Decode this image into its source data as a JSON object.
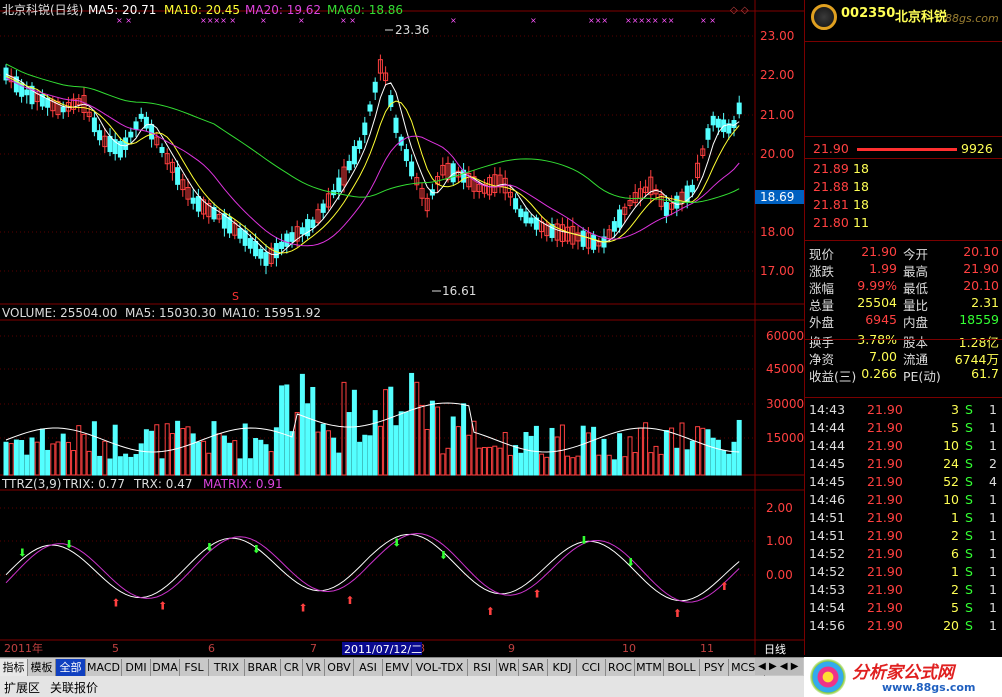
{
  "header": {
    "title": "北京科锐(日线)",
    "ma5": "MA5: 20.71",
    "ma10": "MA10: 20.45",
    "ma20": "MA20: 19.62",
    "ma60": "MA60: 18.86"
  },
  "price_axis": [
    "23.00",
    "22.00",
    "21.00",
    "20.00",
    "18.00",
    "17.00"
  ],
  "price_marker": "18.69",
  "hi_label": "23.36",
  "lo_label": "16.61",
  "signal_s": "S",
  "volume": {
    "label": "VOLUME: 25504.00",
    "ma5": "MA5: 15030.30",
    "ma10": "MA10: 15951.92",
    "axis": [
      "60000",
      "45000",
      "30000",
      "15000"
    ]
  },
  "trix": {
    "label": "TTRZ(3,9)",
    "trix": "TRIX: 0.77",
    "trx": "TRX: 0.47",
    "matrix": "MATRIX: 0.91",
    "axis": [
      "2.00",
      "1.00",
      "0.00"
    ]
  },
  "date_axis": {
    "year": "2011年",
    "months": [
      "5",
      "6",
      "7",
      "8",
      "9",
      "10",
      "11"
    ],
    "cursor": "2011/07/12/二",
    "period": "日线"
  },
  "colors": {
    "up": "#ff4040",
    "down": "#54ffff",
    "ma5": "#ffffff",
    "ma10": "#ffff33",
    "ma20": "#dd33dd",
    "ma60": "#33dd33",
    "grid": "#800000"
  },
  "quote": {
    "code": "002350",
    "name": "北京科锐",
    "ask_book": [
      {
        "p": "21.90",
        "v": "9926"
      }
    ],
    "bid_book": [
      {
        "p": "21.89",
        "v": "18"
      },
      {
        "p": "21.88",
        "v": "18"
      },
      {
        "p": "21.81",
        "v": "18"
      },
      {
        "p": "21.80",
        "v": "11"
      }
    ],
    "fields": [
      {
        "l1": "现价",
        "v1": "21.90",
        "l2": "今开",
        "v2": "20.10"
      },
      {
        "l1": "涨跌",
        "v1": "1.99",
        "l2": "最高",
        "v2": "21.90"
      },
      {
        "l1": "涨幅",
        "v1": "9.99%",
        "l2": "最低",
        "v2": "20.10"
      },
      {
        "l1": "总量",
        "v1": "25504",
        "l2": "量比",
        "v2": "2.31"
      },
      {
        "l1": "外盘",
        "v1": "6945",
        "l2": "内盘",
        "v2": "18559"
      },
      {
        "l1": "换手",
        "v1": "3.78%",
        "l2": "股本",
        "v2": "1.28亿"
      },
      {
        "l1": "净资",
        "v1": "7.00",
        "l2": "流通",
        "v2": "6744万"
      },
      {
        "l1": "收益(三)",
        "v1": "0.266",
        "l2": "PE(动)",
        "v2": "61.7"
      }
    ],
    "ticks": [
      {
        "t": "14:43",
        "p": "21.90",
        "v": "3",
        "s": "S",
        "n": "1"
      },
      {
        "t": "14:44",
        "p": "21.90",
        "v": "5",
        "s": "S",
        "n": "1"
      },
      {
        "t": "14:44",
        "p": "21.90",
        "v": "10",
        "s": "S",
        "n": "1"
      },
      {
        "t": "14:45",
        "p": "21.90",
        "v": "24",
        "s": "S",
        "n": "2"
      },
      {
        "t": "14:45",
        "p": "21.90",
        "v": "52",
        "s": "S",
        "n": "4"
      },
      {
        "t": "14:46",
        "p": "21.90",
        "v": "10",
        "s": "S",
        "n": "1"
      },
      {
        "t": "14:51",
        "p": "21.90",
        "v": "1",
        "s": "S",
        "n": "1"
      },
      {
        "t": "14:51",
        "p": "21.90",
        "v": "2",
        "s": "S",
        "n": "1"
      },
      {
        "t": "14:52",
        "p": "21.90",
        "v": "6",
        "s": "S",
        "n": "1"
      },
      {
        "t": "14:52",
        "p": "21.90",
        "v": "1",
        "s": "S",
        "n": "1"
      },
      {
        "t": "14:53",
        "p": "21.90",
        "v": "2",
        "s": "S",
        "n": "1"
      },
      {
        "t": "14:54",
        "p": "21.90",
        "v": "5",
        "s": "S",
        "n": "1"
      },
      {
        "t": "14:56",
        "p": "21.90",
        "v": "20",
        "s": "S",
        "n": "1"
      }
    ]
  },
  "tabs": [
    "指标",
    "模板",
    "全部",
    "MACD",
    "DMI",
    "DMA",
    "FSL",
    "TRIX",
    "BRAR",
    "CR",
    "VR",
    "OBV",
    "ASI",
    "EMV",
    "VOL-TDX",
    "RSI",
    "WR",
    "SAR",
    "KDJ",
    "CCI",
    "ROC",
    "MTM",
    "BOLL",
    "PSY",
    "MCST"
  ],
  "sub_tabs": [
    "扩展区",
    "关联报价"
  ],
  "watermark": {
    "text": "分析家公式网",
    "url": "www.88gs.com"
  }
}
